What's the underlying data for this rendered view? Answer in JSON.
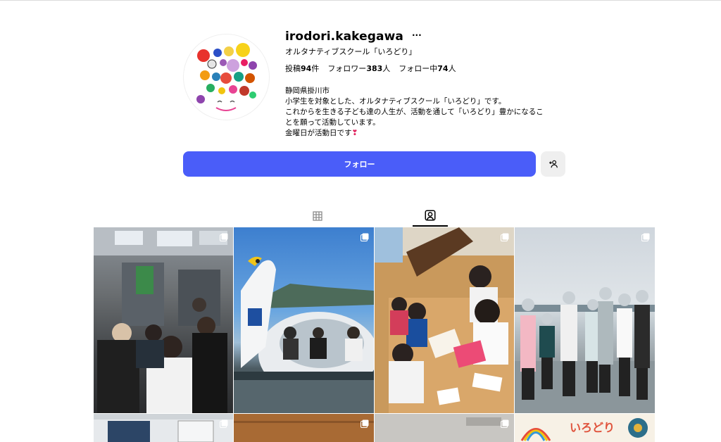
{
  "profile": {
    "username": "irodori.kakegawa",
    "more_label": "···",
    "full_name": "オルタナティブスクール「いろどり」",
    "stats": [
      {
        "label": "投稿",
        "value": "94",
        "suffix": "件"
      },
      {
        "label": "フォロワー",
        "value": "383",
        "suffix": "人"
      },
      {
        "label": "フォロー中",
        "value": "74",
        "suffix": "人"
      }
    ],
    "bio": {
      "line1": "静岡県掛川市",
      "line2": "小学生を対象とした、オルタナティブスクール「いろどり」です。",
      "line3": "これからを生きる子ども達の人生が、活動を通して「いろどり」豊かになるこ",
      "line4": "とを願って活動しています。",
      "line5": "金曜日が活動日です",
      "line5_emoji": "❣"
    }
  },
  "actions": {
    "follow_label": "フォロー",
    "suggest_icon": "person-add-icon"
  },
  "tabs": [
    {
      "name": "posts",
      "icon": "grid-icon",
      "active": false
    },
    {
      "name": "tagged",
      "icon": "tagged-user-icon",
      "active": true
    }
  ],
  "grid_sign_text": "いろどり",
  "colors": {
    "follow_button": "#4a5df9",
    "secondary_button": "#efefef",
    "divider": "#dbdbdb"
  }
}
